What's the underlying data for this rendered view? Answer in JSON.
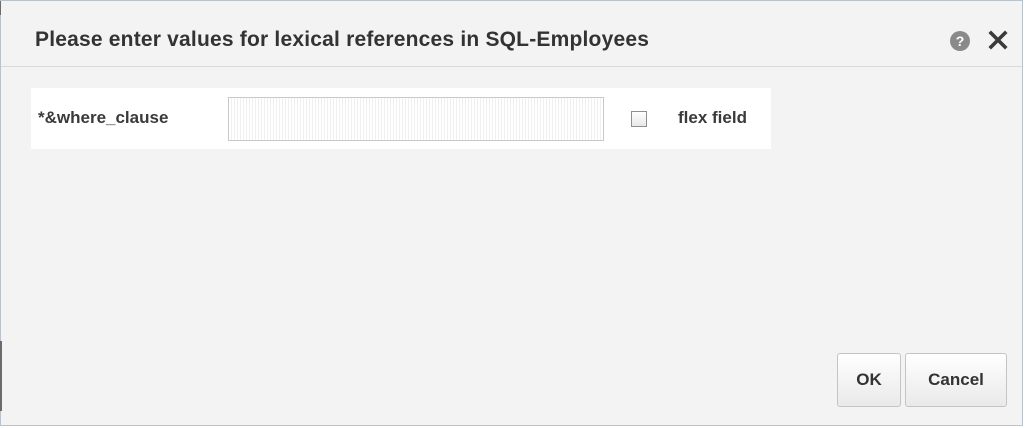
{
  "dialog": {
    "title": "Please enter values for lexical references in SQL-Employees",
    "help_icon_glyph": "?",
    "help_icon": "help-icon",
    "close_icon": "close-icon"
  },
  "form": {
    "field_label": "*&where_clause",
    "field_value": "",
    "field_placeholder": "",
    "checkbox_label": "flex field",
    "checkbox_checked": false
  },
  "buttons": {
    "ok_label": "OK",
    "cancel_label": "Cancel"
  },
  "colors": {
    "dialog_background": "#f3f3f3",
    "panel_background": "#ffffff",
    "title_text": "#333333",
    "help_icon_background": "#8a8a8a"
  }
}
